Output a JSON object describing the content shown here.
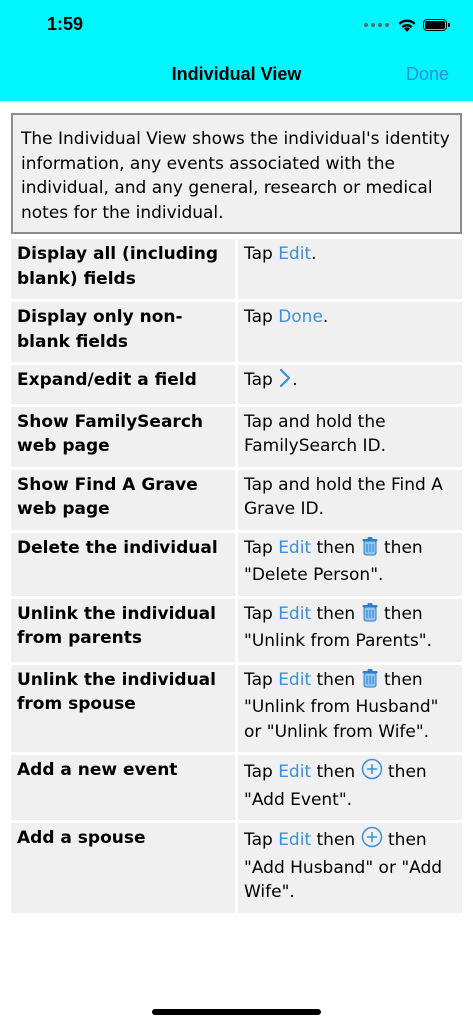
{
  "status": {
    "time": "1:59"
  },
  "nav": {
    "title": "Individual View",
    "done_label": "Done"
  },
  "intro": "The Individual View shows the individual's identity information, any events associated with the individual, and any general, research or medical notes for the individual.",
  "rows": [
    {
      "action": "Display all (including blank) fields",
      "pre": "Tap ",
      "link": "Edit",
      "post": "."
    },
    {
      "action": "Display only non-blank fields",
      "pre": "Tap ",
      "link": "Done",
      "post": "."
    },
    {
      "action": "Expand/edit a field",
      "pre": "Tap ",
      "icon": "chevron-right-icon",
      "post": "."
    },
    {
      "action": "Show FamilySearch web page",
      "text": "Tap and hold the FamilySearch ID."
    },
    {
      "action": "Show Find A Grave web page",
      "text": "Tap and hold the Find A Grave ID."
    },
    {
      "action": "Delete the individual",
      "pre": "Tap ",
      "link": "Edit",
      "mid": " then ",
      "icon": "trash-icon",
      "post": " then \"Delete Person\"."
    },
    {
      "action": "Unlink the individual from parents",
      "pre": "Tap ",
      "link": "Edit",
      "mid": " then ",
      "icon": "trash-icon",
      "post": " then \"Unlink from Parents\"."
    },
    {
      "action": "Unlink the individual from spouse",
      "pre": "Tap ",
      "link": "Edit",
      "mid": " then ",
      "icon": "trash-icon",
      "post": " then \"Unlink from Husband\" or \"Unlink from Wife\"."
    },
    {
      "action": "Add a new event",
      "pre": "Tap ",
      "link": "Edit",
      "mid": " then ",
      "icon": "plus-circle-icon",
      "post": " then \"Add Event\"."
    },
    {
      "action": "Add a spouse",
      "pre": "Tap ",
      "link": "Edit",
      "mid": " then ",
      "icon": "plus-circle-icon",
      "post": " then \"Add Husband\" or \"Add Wife\"."
    }
  ],
  "colors": {
    "header_bg": "#00F5FC",
    "link": "#3A90DA",
    "row_bg": "#F0F0F0"
  }
}
